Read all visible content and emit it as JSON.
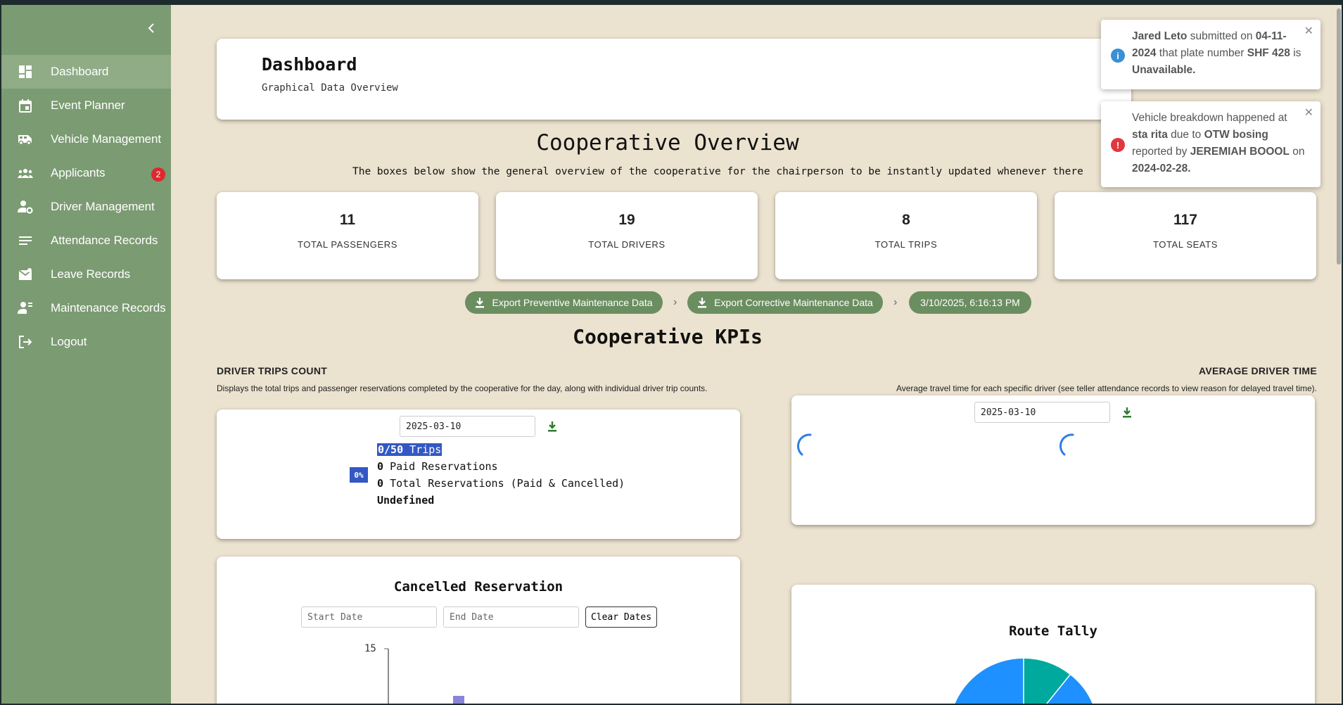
{
  "sidebar": {
    "items": [
      {
        "label": "Dashboard",
        "icon": "dashboard-icon",
        "active": true
      },
      {
        "label": "Event Planner",
        "icon": "calendar-icon"
      },
      {
        "label": "Vehicle Management",
        "icon": "van-icon"
      },
      {
        "label": "Applicants",
        "icon": "group-icon",
        "badge": "2"
      },
      {
        "label": "Driver Management",
        "icon": "user-gear-icon"
      },
      {
        "label": "Attendance Records",
        "icon": "lines-icon"
      },
      {
        "label": "Leave Records",
        "icon": "mail-icon"
      },
      {
        "label": "Maintenance Records",
        "icon": "user-wrench-icon"
      },
      {
        "label": "Logout",
        "icon": "logout-icon"
      }
    ]
  },
  "header": {
    "title": "Dashboard",
    "subtitle": "Graphical Data Overview"
  },
  "overview": {
    "title": "Cooperative Overview",
    "description": "The boxes below show the general overview of the cooperative for the chairperson to be instantly updated whenever there"
  },
  "stats": [
    {
      "value": "11",
      "label": "TOTAL PASSENGERS"
    },
    {
      "value": "19",
      "label": "TOTAL DRIVERS"
    },
    {
      "value": "8",
      "label": "TOTAL TRIPS"
    },
    {
      "value": "117",
      "label": "TOTAL SEATS"
    }
  ],
  "actions": {
    "export_preventive": "Export Preventive Maintenance Data",
    "export_corrective": "Export Corrective Maintenance Data",
    "timestamp": "3/10/2025, 6:16:13 PM"
  },
  "kpis": {
    "title": "Cooperative KPIs",
    "driver_trips": {
      "label": "DRIVER TRIPS COUNT",
      "description": "Displays the total trips and passenger reservations completed by the cooperative for the day, along with individual driver trip counts.",
      "date": "2025-03-10",
      "percent": "0%",
      "trips_value": "0/50",
      "trips_text": "Trips",
      "paid_value": "0",
      "paid_text": "Paid Reservations",
      "total_value": "0",
      "total_text": "Total Reservations (Paid & Cancelled)",
      "status": "Undefined"
    },
    "avg_driver_time": {
      "label": "AVERAGE DRIVER TIME",
      "description": "Average travel time for each specific driver (see teller attendance records to view reason for delayed travel time).",
      "date": "2025-03-10"
    },
    "cancelled": {
      "title": "Cancelled Reservation",
      "start_placeholder": "Start Date",
      "end_placeholder": "End Date",
      "clear_label": "Clear Dates",
      "y_tick_top": "15"
    },
    "route_tally": {
      "title": "Route Tally"
    }
  },
  "toasts": [
    {
      "type": "info",
      "name": "Jared Leto",
      "t1": " submitted on ",
      "date": "04-11-2024",
      "t2": " that plate number ",
      "plate": "SHF 428",
      "t3": " is ",
      "status": "Unavailable."
    },
    {
      "type": "error",
      "t1": "Vehicle breakdown happened at ",
      "place": "sta rita",
      "t2": " due to ",
      "reason": "OTW bosing",
      "t3": " reported by ",
      "reporter": "JEREMIAH BOOOL",
      "t4": " on ",
      "date": "2024-02-28."
    }
  ],
  "colors": {
    "sidebar": "#7b9b72",
    "accent": "#6b8e61",
    "info": "#3a8fd6",
    "error": "#e0383e",
    "download": "#2e7d32"
  }
}
